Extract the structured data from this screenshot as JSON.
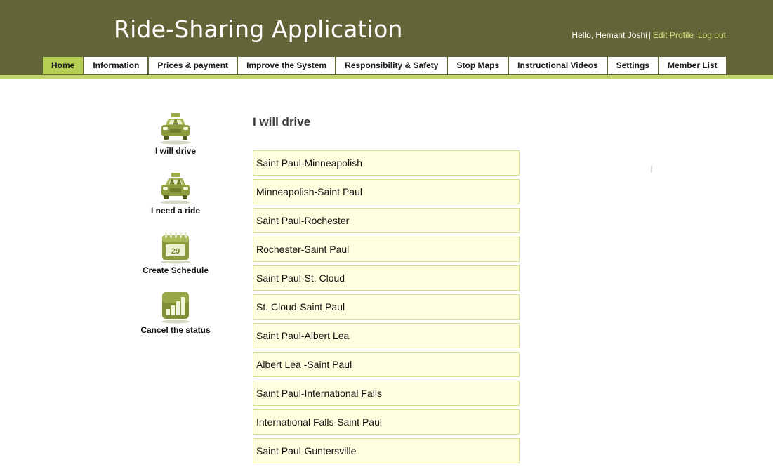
{
  "header": {
    "title": "Ride-Sharing Application",
    "greeting": "Hello, Hemant Joshi",
    "separator": "|",
    "edit_profile": "Edit Profile",
    "logout": "Log out"
  },
  "nav": {
    "tabs": [
      {
        "label": "Home",
        "active": true
      },
      {
        "label": "Information"
      },
      {
        "label": "Prices & payment"
      },
      {
        "label": "Improve the System"
      },
      {
        "label": "Responsibility & Safety"
      },
      {
        "label": "Stop Maps"
      },
      {
        "label": "Instructional Videos"
      },
      {
        "label": "Settings"
      },
      {
        "label": "Member List"
      }
    ]
  },
  "sidebar": {
    "items": [
      {
        "label": "I will drive",
        "icon": "taxi-driver-icon"
      },
      {
        "label": "I need a ride",
        "icon": "taxi-passengers-icon"
      },
      {
        "label": "Create Schedule",
        "icon": "calendar-icon",
        "calendar_day": "29"
      },
      {
        "label": "Cancel the status",
        "icon": "bar-chart-icon"
      }
    ]
  },
  "main": {
    "heading": "I will drive",
    "routes": [
      "Saint Paul-Minneapolish",
      "Minneapolish-Saint Paul",
      "Saint Paul-Rochester",
      "Rochester-Saint Paul",
      "Saint Paul-St. Cloud",
      "St. Cloud-Saint Paul",
      "Saint Paul-Albert Lea",
      "Albert Lea -Saint Paul",
      "Saint Paul-International Falls",
      "International Falls-Saint Paul",
      "Saint Paul-Guntersville"
    ]
  },
  "colors": {
    "header_bg": "#636538",
    "accent_stripe": "#c3d66b",
    "active_tab": "#b5cf55",
    "link": "#d9e27a",
    "route_bg": "#ffffe0",
    "route_border": "#d8e093",
    "icon_green": "#8a9a3c"
  }
}
